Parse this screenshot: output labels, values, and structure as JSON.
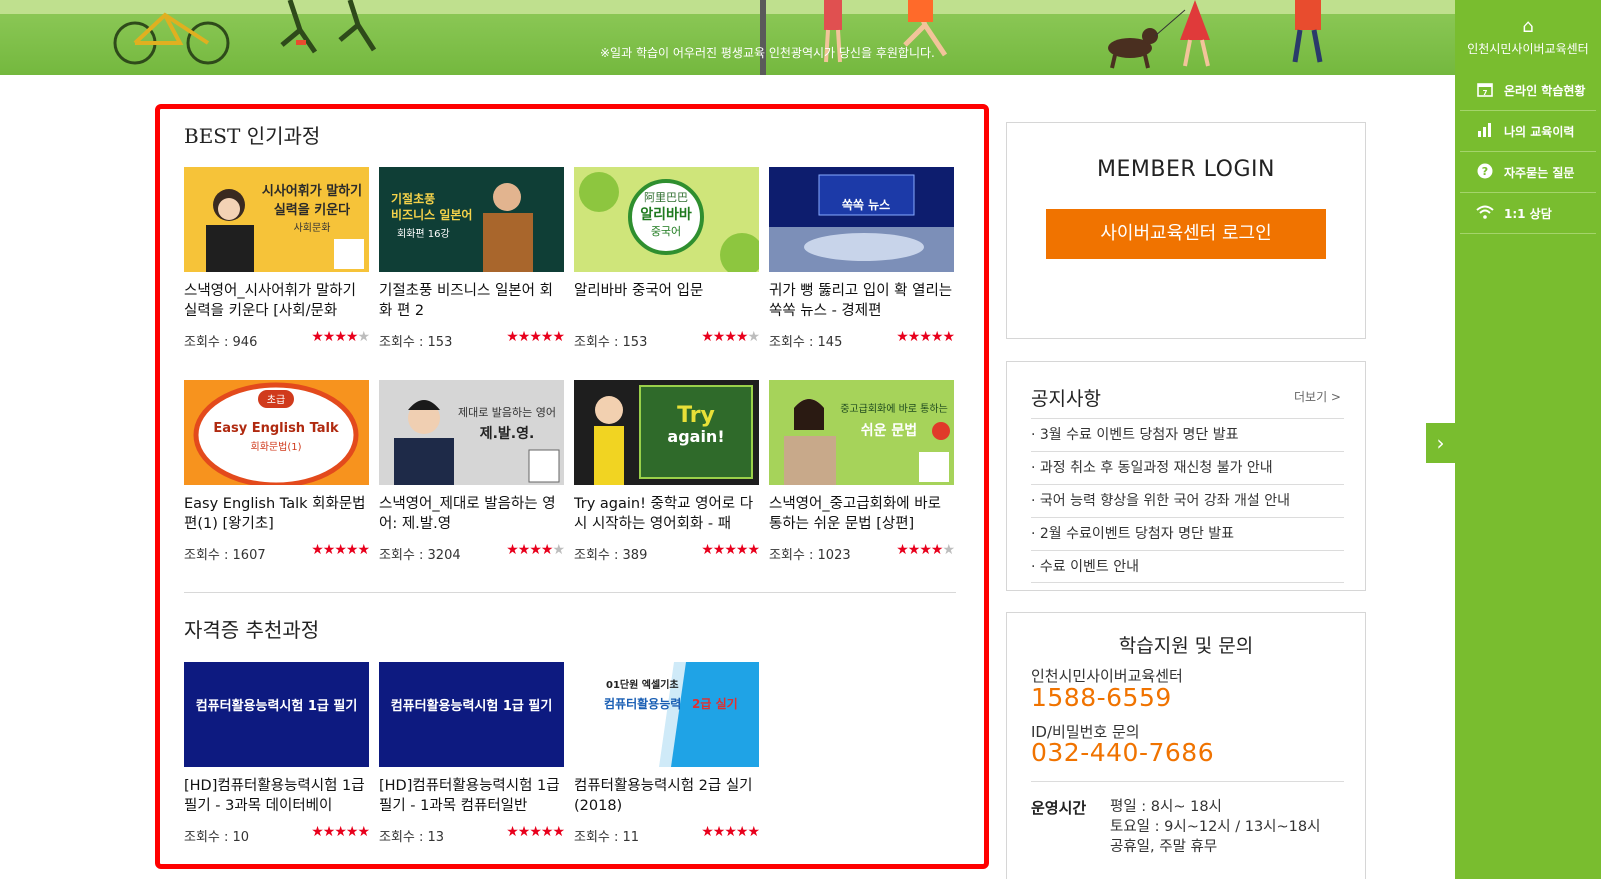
{
  "banner": {
    "tagline": "※일과 학습이 어우러진 평생교육 인천광역시가 당신을 후원합니다."
  },
  "best": {
    "title": "BEST 인기과정",
    "courses": [
      {
        "title": "스낵영어_시사어휘가 말하기 실력을 키운다 [사회/문화",
        "views": "조회수 : 946",
        "rating": 4,
        "thumb_text": "시사어휘가 말하기 실력을 키운다 사회문화"
      },
      {
        "title": "기절초풍 비즈니스 일본어 회화 편 2",
        "views": "조회수 : 153",
        "rating": 5,
        "thumb_text": "기절초풍 비즈니스 일본어 회화편 16강"
      },
      {
        "title": "알리바바 중국어 입문",
        "views": "조회수 : 153",
        "rating": 4,
        "thumb_text": "阿里巴巴 알리바바 중국어"
      },
      {
        "title": "귀가 뻥 뚫리고 입이 확 열리는 쏙쏙 뉴스 - 경제편",
        "views": "조회수 : 145",
        "rating": 5,
        "thumb_text": "쏙쏙 뉴스"
      },
      {
        "title": "Easy English Talk 회화문법 편(1) [왕기초]",
        "views": "조회수 : 1607",
        "rating": 5,
        "thumb_text": "Easy English Talk 회화문법(1)"
      },
      {
        "title": "스낵영어_제대로 발음하는 영어: 제.발.영",
        "views": "조회수 : 3204",
        "rating": 4,
        "thumb_text": "제대로 발음하는 영어 제.발.영."
      },
      {
        "title": "Try again! 중학교 영어로 다시 시작하는 영어회화 - 패",
        "views": "조회수 : 389",
        "rating": 5,
        "thumb_text": "Try again!"
      },
      {
        "title": "스낵영어_중고급회화에 바로 통하는 쉬운 문법 [상편]",
        "views": "조회수 : 1023",
        "rating": 4,
        "thumb_text": "중고급회화에 바로 통하는 쉬운 문법 상"
      }
    ]
  },
  "cert": {
    "title": "자격증 추천과정",
    "courses": [
      {
        "title": "[HD]컴퓨터활용능력시험 1급 필기 - 3과목 데이터베이",
        "views": "조회수 : 10",
        "rating": 5,
        "thumb_text": "컴퓨터활용능력시험 1급 필기"
      },
      {
        "title": "[HD]컴퓨터활용능력시험 1급 필기 - 1과목 컴퓨터일반",
        "views": "조회수 : 13",
        "rating": 5,
        "thumb_text": "컴퓨터활용능력시험 1급 필기"
      },
      {
        "title": "컴퓨터활용능력시험 2급 실기(2018)",
        "views": "조회수 : 11",
        "rating": 5,
        "thumb_text": "01단원 엑셀기초 컴퓨터활용능력 2급 실기"
      }
    ]
  },
  "login": {
    "title": "MEMBER LOGIN",
    "button": "사이버교육센터 로그인"
  },
  "notice": {
    "title": "공지사항",
    "more": "더보기 >",
    "items": [
      "· 3월 수료 이벤트 당첨자 명단 발표",
      "· 과정 취소 후 동일과정 재신청 불가 안내",
      "· 국어 능력 향상을 위한 국어 강좌 개설 안내",
      "· 2월 수료이벤트 당첨자 명단 발표",
      "· 수료 이벤트 안내"
    ]
  },
  "support": {
    "title": "학습지원 및 문의",
    "center_label": "인천시민사이버교육센터",
    "center_phone": "1588-6559",
    "id_label": "ID/비밀번호 문의",
    "id_phone": "032-440-7686",
    "hours_label": "운영시간",
    "hours": [
      "평일 : 8시~ 18시",
      "토요일 : 9시~12시 / 13시~18시",
      "공휴일, 주말 휴무"
    ]
  },
  "sidebar": {
    "home": "인천시민사이버교육센터",
    "items": [
      {
        "label": "온라인 학습현황",
        "icon": "calendar-icon"
      },
      {
        "label": "나의 교육이력",
        "icon": "bar-chart-icon"
      },
      {
        "label": "자주묻는 질문",
        "icon": "question-icon"
      },
      {
        "label": "1:1 상담",
        "icon": "wifi-icon"
      }
    ]
  },
  "colors": {
    "accent_green": "#79bd2f",
    "accent_orange": "#f07300",
    "highlight_red": "#ff0000",
    "star_red": "#e8001c"
  }
}
